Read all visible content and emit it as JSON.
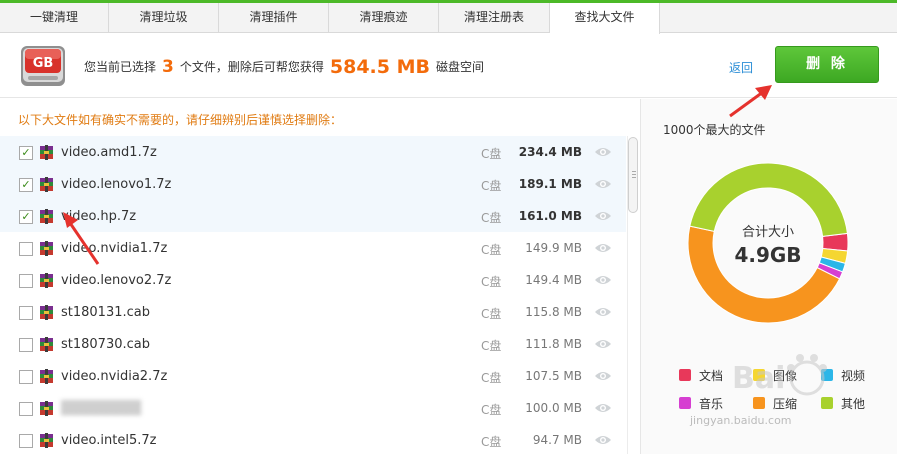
{
  "tabs": [
    "一键清理",
    "清理垃圾",
    "清理插件",
    "清理痕迹",
    "清理注册表",
    "查找大文件"
  ],
  "active_tab": 5,
  "header": {
    "icon_text": "GB",
    "summary_pre": "您当前已选择",
    "selected_count": "3",
    "summary_mid": "个文件，删除后可帮您获得",
    "freed_size": "584.5 MB",
    "summary_post": "磁盘空间",
    "back_label": "返回",
    "delete_label": "删 除"
  },
  "notice": "以下大文件如有确实不需要的，请仔细辨别后谨慎选择删除：",
  "files": [
    {
      "name": "video.amd1.7z",
      "drive": "C盘",
      "size": "234.4 MB",
      "checked": true
    },
    {
      "name": "video.lenovo1.7z",
      "drive": "C盘",
      "size": "189.1 MB",
      "checked": true
    },
    {
      "name": "video.hp.7z",
      "drive": "C盘",
      "size": "161.0 MB",
      "checked": true
    },
    {
      "name": "video.nvidia1.7z",
      "drive": "C盘",
      "size": "149.9 MB",
      "checked": false
    },
    {
      "name": "video.lenovo2.7z",
      "drive": "C盘",
      "size": "149.4 MB",
      "checked": false
    },
    {
      "name": "st180131.cab",
      "drive": "C盘",
      "size": "115.8 MB",
      "checked": false
    },
    {
      "name": "st180730.cab",
      "drive": "C盘",
      "size": "111.8 MB",
      "checked": false
    },
    {
      "name": "video.nvidia2.7z",
      "drive": "C盘",
      "size": "107.5 MB",
      "checked": false
    },
    {
      "name": "",
      "drive": "C盘",
      "size": "100.0 MB",
      "checked": false,
      "blurred": true
    },
    {
      "name": "video.intel5.7z",
      "drive": "C盘",
      "size": "94.7 MB",
      "checked": false
    }
  ],
  "right_panel": {
    "title": "1000个最大的文件",
    "total_label": "合计大小",
    "total_value": "4.9GB"
  },
  "chart_data": {
    "type": "pie",
    "style": "donut",
    "center_label": "合计大小",
    "center_value": "4.9GB",
    "categories": [
      "文档",
      "图像",
      "视频",
      "音乐",
      "压缩",
      "其他"
    ],
    "colors": [
      "#e8385a",
      "#f5d631",
      "#2bb6e8",
      "#d63fd1",
      "#f7941e",
      "#a8d12e"
    ],
    "values": [
      3.5,
      2.5,
      1.8,
      1.5,
      46,
      44.7
    ]
  },
  "watermark": "jingyan.baidu.com",
  "colors": {
    "accent": "#4cb928",
    "orange": "#f36b0b",
    "link": "#2b8ed6"
  }
}
